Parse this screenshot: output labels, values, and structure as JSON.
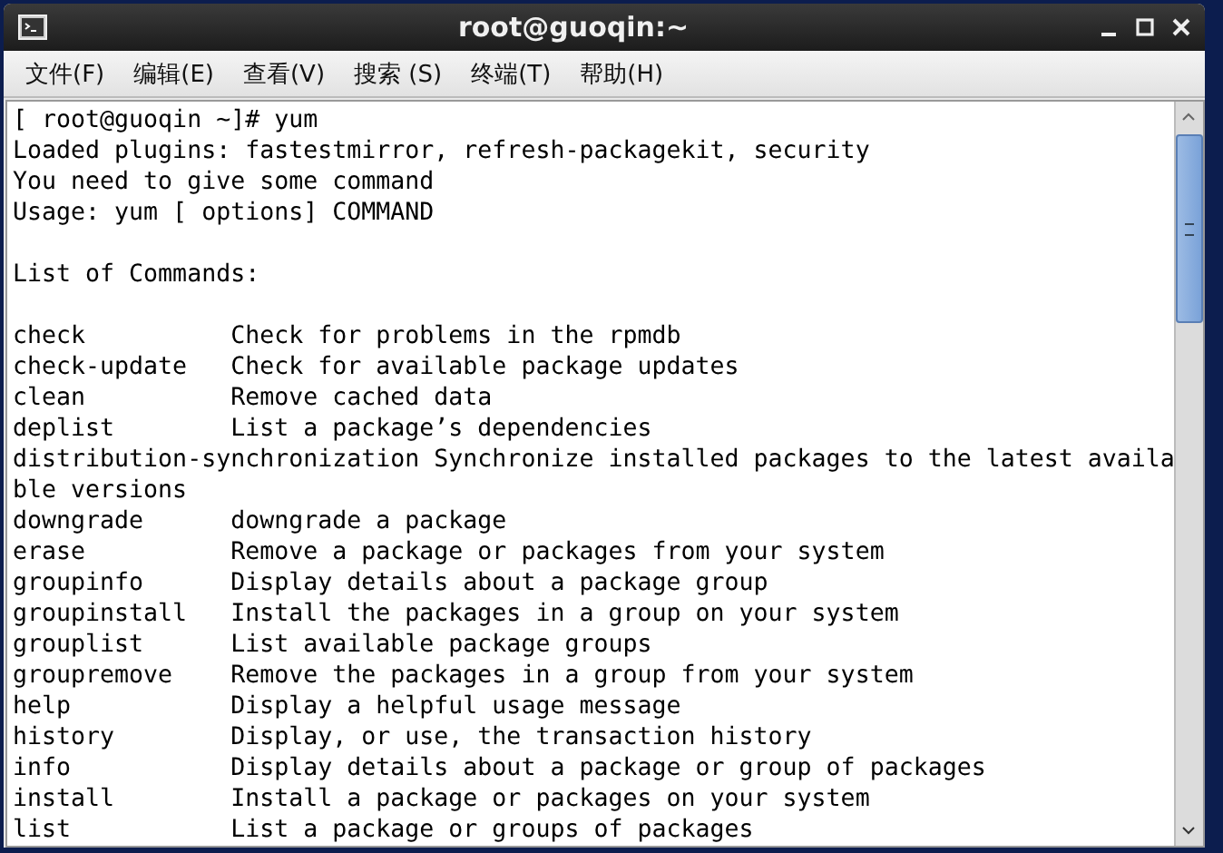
{
  "window": {
    "title": "root@guoqin:~"
  },
  "menu": [
    "文件(F)",
    "编辑(E)",
    "查看(V)",
    "搜索 (S)",
    "终端(T)",
    "帮助(H)"
  ],
  "terminal": {
    "blocks": [
      [
        "[ root@guoqin ~]# yum",
        "Loaded plugins: fastestmirror, refresh-packagekit, security",
        "You need to give some command",
        "Usage: yum [ options] COMMAND"
      ],
      [
        "List of Commands:"
      ],
      [
        "check          Check for problems in the rpmdb",
        "check-update   Check for available package updates",
        "clean          Remove cached data",
        "deplist        List a package’s dependencies",
        "distribution-synchronization Synchronize installed packages to the latest availa",
        "ble versions",
        "downgrade      downgrade a package",
        "erase          Remove a package or packages from your system",
        "groupinfo      Display details about a package group",
        "groupinstall   Install the packages in a group on your system",
        "grouplist      List available package groups",
        "groupremove    Remove the packages in a group from your system",
        "help           Display a helpful usage message",
        "history        Display, or use, the transaction history",
        "info           Display details about a package or group of packages",
        "install        Install a package or packages on your system",
        "list           List a package or groups of packages"
      ]
    ]
  }
}
